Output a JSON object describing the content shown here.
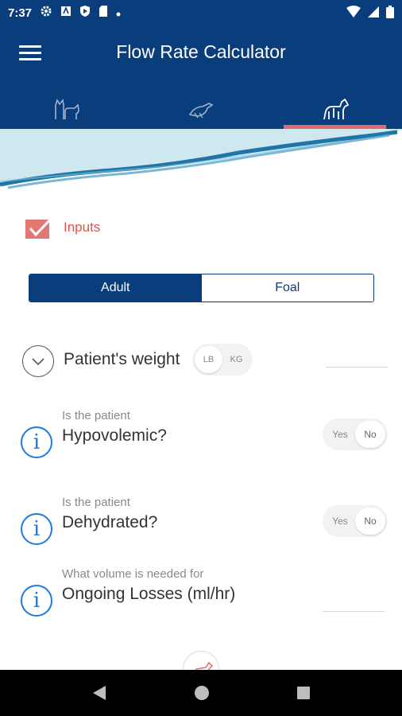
{
  "status_bar": {
    "time": "7:37"
  },
  "app": {
    "title": "Flow Rate Calculator"
  },
  "tabs": [
    {
      "icon": "cat-dog-icon",
      "active": false
    },
    {
      "icon": "bird-icon",
      "active": false
    },
    {
      "icon": "horse-icon",
      "active": true
    }
  ],
  "inputs_section": {
    "label": "Inputs"
  },
  "age_toggle": {
    "options": [
      "Adult",
      "Foal"
    ],
    "selected": "Adult"
  },
  "weight": {
    "title": "Patient's weight",
    "units": [
      "LB",
      "KG"
    ],
    "selected_unit": "LB"
  },
  "hypovolemic": {
    "sub": "Is the patient",
    "question": "Hypovolemic?",
    "options": [
      "Yes",
      "No"
    ],
    "selected": "No"
  },
  "dehydrated": {
    "sub": "Is the patient",
    "question": "Dehydrated?",
    "options": [
      "Yes",
      "No"
    ],
    "selected": "No"
  },
  "ongoing_losses": {
    "sub": "What volume is needed for",
    "question": "Ongoing Losses (ml/hr)"
  },
  "colors": {
    "primary": "#0a3d7c",
    "accent": "#e06a6a",
    "info": "#1e7be0"
  }
}
